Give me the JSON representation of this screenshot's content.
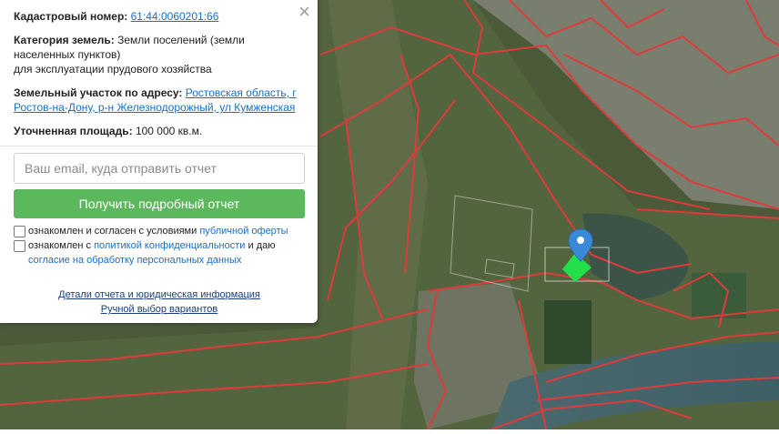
{
  "map": {
    "marker_icon": "map-pin-icon",
    "colors": {
      "boundary": "#e03a3a",
      "parcel_highlight": "#22e04a",
      "marker": "#3b8ad9"
    }
  },
  "panel": {
    "cadastral_label": "Кадастровый номер:",
    "cadastral_value": "61:44:0060201:66",
    "category_label": "Категория земель:",
    "category_value": "Земли поселений (земли населенных пунктов)",
    "category_extra": "для эксплуатации прудового хозяйства",
    "address_label": "Земельный участок по адресу:",
    "address_value": "Ростовская область, г Ростов-на-Дону, р-н Железнодорожный, ул Кумженская",
    "area_label": "Уточненная площадь:",
    "area_value": "100 000 кв.м.",
    "email_placeholder": "Ваш email, куда отправить отчет",
    "submit_label": "Получить подробный отчет",
    "check1_text": "ознакомлен и согласен с условиями",
    "check1_link": "публичной оферты",
    "check2_text": "ознакомлен с",
    "check2_link": "политикой конфиденциальности",
    "check2_text2": "и даю",
    "check2_link2": "согласие на обработку персональных данных",
    "details_link": "Детали отчета и юридическая информация",
    "manual_link": "Ручной выбор вариантов",
    "close_icon": "×"
  }
}
